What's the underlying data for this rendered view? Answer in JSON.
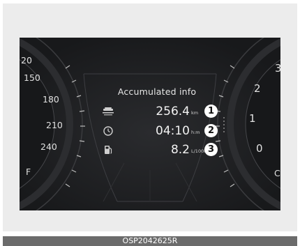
{
  "panel": {
    "title": "Accumulated info"
  },
  "rows": [
    {
      "icon": "distance-road-icon",
      "value": "256.4",
      "unit": "km",
      "badge": "1"
    },
    {
      "icon": "clock-icon",
      "value": "04:10",
      "unit": "h:m",
      "badge": "2"
    },
    {
      "icon": "fuel-pump-icon",
      "value": "8.2",
      "unit": "L/100km",
      "badge": "3"
    }
  ],
  "left_gauge": {
    "labels": [
      "20",
      "150",
      "180",
      "210",
      "240",
      "F"
    ]
  },
  "right_gauge": {
    "labels": [
      "3",
      "2",
      "1",
      "0",
      "C"
    ]
  },
  "caption": "OSP2042625R",
  "colors": {
    "cluster_bg": "#1c1d1f",
    "frame_bg": "#ececec",
    "caption_bar": "#6b6b6b",
    "text": "#f2f2f2"
  }
}
